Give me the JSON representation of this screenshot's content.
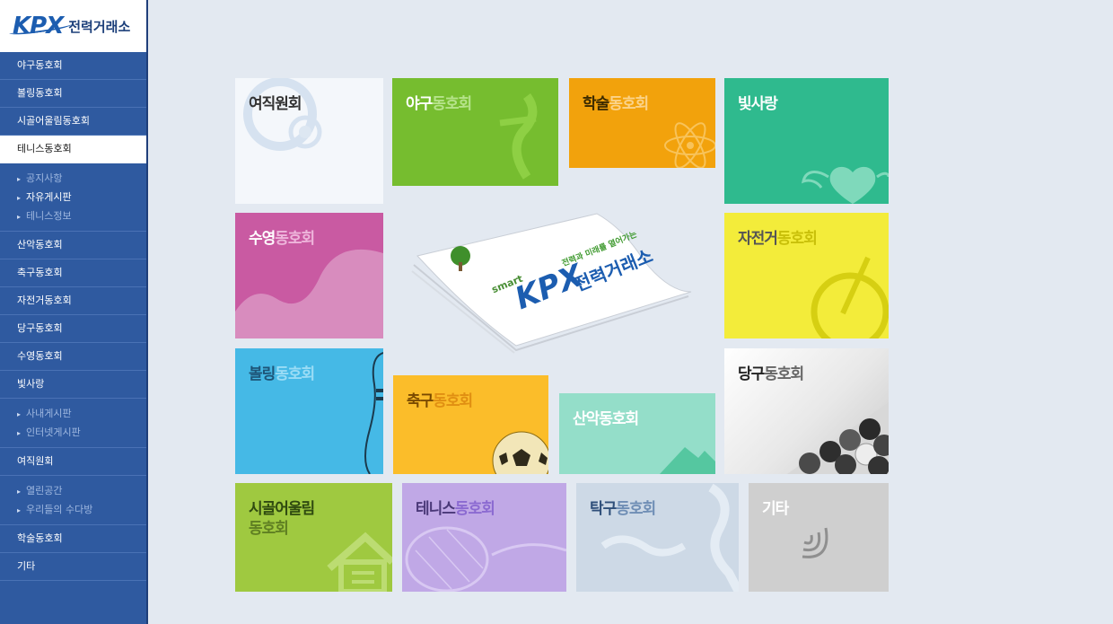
{
  "logo": {
    "brand": "KPX",
    "name": "전력거래소"
  },
  "sidebar": {
    "items": [
      {
        "label": "야구동호회",
        "active": false
      },
      {
        "label": "볼링동호회",
        "active": false
      },
      {
        "label": "시골어울림동호회",
        "active": false
      },
      {
        "label": "테니스동호회",
        "active": true
      },
      {
        "label": "산악동호회",
        "active": false
      },
      {
        "label": "축구동호회",
        "active": false
      },
      {
        "label": "자전거동호회",
        "active": false
      },
      {
        "label": "당구동호회",
        "active": false
      },
      {
        "label": "수영동호회",
        "active": false
      },
      {
        "label": "빛사랑",
        "active": false
      },
      {
        "label": "여직원회",
        "active": false
      },
      {
        "label": "학술동호회",
        "active": false
      },
      {
        "label": "기타",
        "active": false
      }
    ],
    "tennis_sub": [
      "공지사항",
      "자유게시판",
      "테니스정보"
    ],
    "light_sub": [
      "사내게시판",
      "인터넷게시판"
    ],
    "women_sub": [
      "열린공간",
      "우리들의 수다방"
    ]
  },
  "tiles": {
    "women": {
      "a": "여직원회",
      "b": ""
    },
    "baseball": {
      "a": "야구",
      "b": "동호회"
    },
    "academic": {
      "a": "학술",
      "b": "동호회"
    },
    "light": {
      "a": "빛사랑",
      "b": ""
    },
    "swim": {
      "a": "수영",
      "b": "동호회"
    },
    "bike": {
      "a": "자전거",
      "b": "동호회"
    },
    "bowling": {
      "a": "볼링",
      "b": "동호회"
    },
    "soccer": {
      "a": "축구",
      "b": "동호회"
    },
    "mountain": {
      "a": "산악동호회",
      "b": ""
    },
    "billiards": {
      "a": "당구",
      "b": "동호회"
    },
    "rural": {
      "a": "시골어울림",
      "b": "동호회"
    },
    "tennis": {
      "a": "테니스",
      "b": "동호회"
    },
    "tabletennis": {
      "a": "탁구",
      "b": "동호회"
    },
    "etc": {
      "a": "기타",
      "b": ""
    }
  },
  "center": {
    "smart": "smart",
    "brand": "KPX",
    "slogan": "전력과 미래를 열어가는",
    "name": "전력거래소"
  },
  "colors": {
    "sidebar": "#2f5aa0",
    "baseball": "#76bd2f",
    "academic": "#f2a20c",
    "light": "#2fba8e",
    "swim": "#c95aa2",
    "bike": "#f3ec3a",
    "bowling": "#45b9e6",
    "soccer": "#fbbd2a",
    "mountain": "#94dec9",
    "rural": "#9fc940",
    "tennis": "#c0a8e6",
    "tabletennis": "#cdd9e6",
    "etc": "#cfcfcf"
  }
}
